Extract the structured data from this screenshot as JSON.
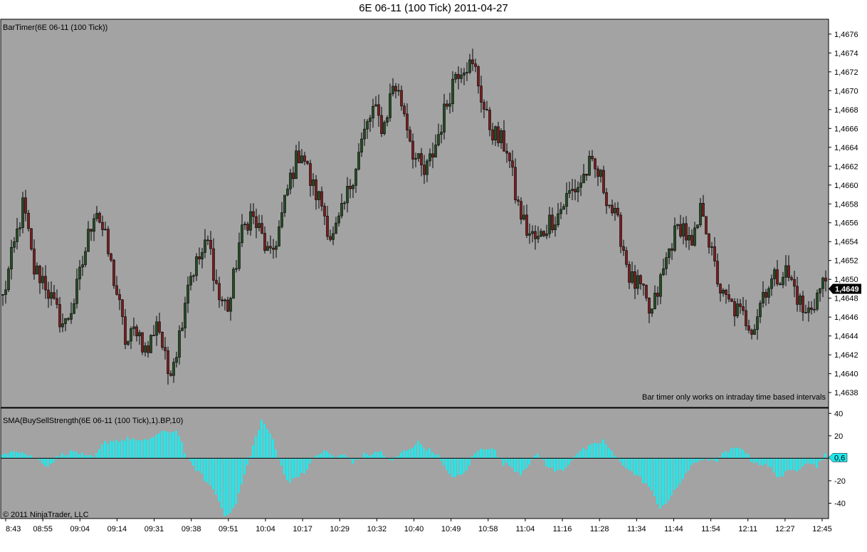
{
  "window": {
    "title": "6E 06-11 (100 Tick)  2011-04-27"
  },
  "colors": {
    "plot_bg": "#a3a3a3",
    "up_body": "#244d24",
    "down_body": "#7c1c1c",
    "wick": "#000000",
    "histogram": "#22e8ec",
    "axis_text": "#000000",
    "last_price_bg": "#000000",
    "last_price_fg": "#ffffff",
    "indicator_value_bg": "#22e8ec"
  },
  "price_panel": {
    "indicator_label": "BarTimer(6E 06-11 (100 Tick))",
    "note": "Bar timer only works on intraday time based intervals",
    "last_price": "1,4649"
  },
  "indicator_panel": {
    "indicator_label": "SMA(BuySellStrength(6E 06-11 (100 Tick),1).BP,10)",
    "current_value": "0,6",
    "copyright": "© 2011 NinjaTrader, LLC"
  },
  "chart_data": [
    {
      "type": "candlestick",
      "title": "6E 06-11 (100 Tick)  2011-04-27",
      "y_tick_labels": [
        "1,4638",
        "1,4640",
        "1,4642",
        "1,4644",
        "1,4646",
        "1,4648",
        "1,4650",
        "1,4652",
        "1,4654",
        "1,4656",
        "1,4658",
        "1,4660",
        "1,4662",
        "1,4664",
        "1,4666",
        "1,4668",
        "1,4670",
        "1,4672",
        "1,4674",
        "1,4676"
      ],
      "ylim": [
        1.46365,
        1.46775
      ],
      "x_tick_labels": [
        "8:43",
        "08:55",
        "09:04",
        "09:14",
        "09:31",
        "09:38",
        "09:51",
        "10:04",
        "10:17",
        "10:29",
        "10:32",
        "10:40",
        "10:49",
        "10:58",
        "11:04",
        "11:16",
        "11:28",
        "11:34",
        "11:44",
        "11:54",
        "12:11",
        "12:27",
        "12:45"
      ],
      "anchor_closes": [
        1.4648,
        1.4653,
        1.4658,
        1.4651,
        1.465,
        1.4647,
        1.4645,
        1.4648,
        1.4653,
        1.4658,
        1.4654,
        1.4649,
        1.4643,
        1.4645,
        1.4642,
        1.4646,
        1.464,
        1.4643,
        1.465,
        1.4652,
        1.4654,
        1.4648,
        1.4647,
        1.4654,
        1.4657,
        1.4655,
        1.4652,
        1.4656,
        1.4661,
        1.4664,
        1.466,
        1.4658,
        1.4654,
        1.4657,
        1.4661,
        1.4665,
        1.4668,
        1.4666,
        1.4671,
        1.4668,
        1.4663,
        1.4661,
        1.4664,
        1.4668,
        1.4672,
        1.4673,
        1.4672,
        1.4667,
        1.4665,
        1.4664,
        1.4658,
        1.4655,
        1.4654,
        1.4656,
        1.4657,
        1.4659,
        1.466,
        1.4662,
        1.4661,
        1.4658,
        1.4655,
        1.465,
        1.4649,
        1.4646,
        1.465,
        1.4654,
        1.4656,
        1.4653,
        1.4658,
        1.4652,
        1.4648,
        1.4647,
        1.4646,
        1.4645,
        1.4649,
        1.465,
        1.4651,
        1.4649,
        1.4646,
        1.4648,
        1.465
      ],
      "last_price": 1.4649
    },
    {
      "type": "bar",
      "series_name": "SMA(BuySellStrength(6E 06-11 (100 Tick),1).BP,10)",
      "y_tick_labels": [
        "40",
        "20",
        "-20",
        "-40"
      ],
      "ylim": [
        -53,
        44
      ],
      "anchor_values": [
        3,
        8,
        6,
        2,
        -2,
        -7,
        2,
        5,
        6,
        1,
        1,
        14,
        16,
        16,
        18,
        14,
        18,
        22,
        24,
        24,
        -2,
        -10,
        -20,
        -30,
        -50,
        -46,
        -20,
        8,
        34,
        22,
        -4,
        -22,
        -15,
        -10,
        4,
        6,
        1,
        3,
        -4,
        3,
        4,
        6,
        -4,
        4,
        9,
        14,
        8,
        4,
        -12,
        -17,
        -14,
        4,
        9,
        10,
        -4,
        -7,
        -14,
        -4,
        4,
        -8,
        -12,
        -8,
        4,
        8,
        12,
        16,
        4,
        -4,
        -12,
        -18,
        -26,
        -44,
        -38,
        -26,
        -12,
        -4,
        1,
        -4,
        4,
        8,
        10,
        -2,
        -5,
        -8,
        -17,
        -12,
        -10,
        -2,
        -8,
        4
      ],
      "current_value": 0.6
    }
  ]
}
